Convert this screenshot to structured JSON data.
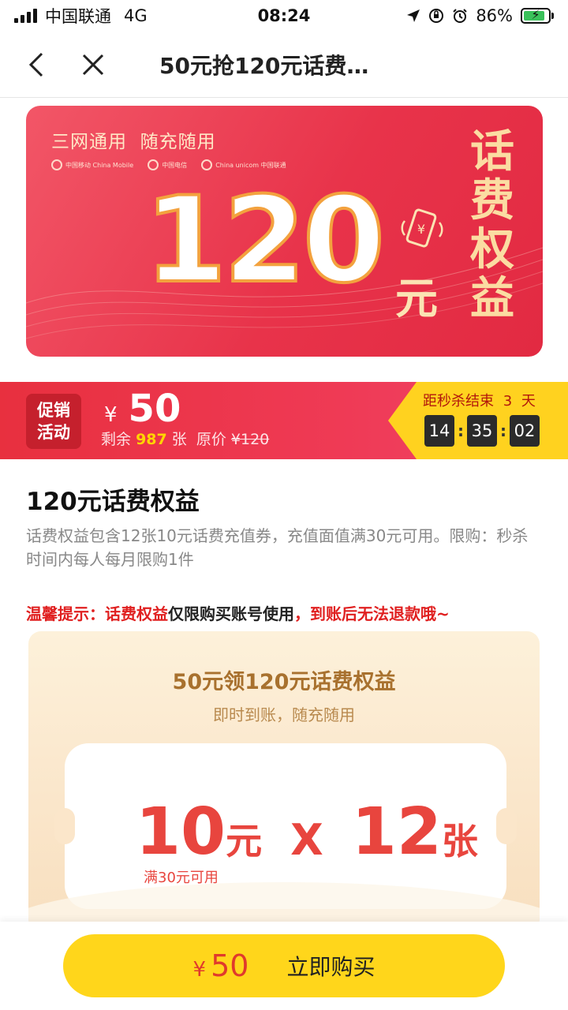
{
  "status_bar": {
    "carrier": "中国联通",
    "network": "4G",
    "time": "08:24",
    "battery": "86%",
    "battery_level": 0.86
  },
  "nav": {
    "title": "50元抢120元话费…"
  },
  "banner": {
    "slogan": "三网通用  随充随用",
    "logos": [
      "中国移动 China Mobile",
      "中国电信",
      "China unicom 中国联通"
    ],
    "amount": "120",
    "unit": "元",
    "vertical_title": "话费权益",
    "phone_icon_symbol": "¥"
  },
  "promo": {
    "badge_line1": "促销",
    "badge_line2": "活动",
    "currency": "¥",
    "price": "50",
    "remaining_prefix": "剩余",
    "remaining_count": "987",
    "remaining_suffix": "张  原价",
    "original_price": "¥120",
    "countdown_label": "距秒杀结束",
    "countdown_days": "3",
    "countdown_days_unit": "天",
    "hours": "14",
    "minutes": "35",
    "seconds": "02"
  },
  "product": {
    "title": "120元话费权益",
    "description": "话费权益包含12张10元话费充值券，充值面值满30元可用。限购：秒杀时间内每人每月限购1件",
    "notice_part1": "温馨提示：话费权益",
    "notice_part2": "仅限购买账号使用",
    "notice_part3": "，到账后无法退款哦~"
  },
  "coupon_card": {
    "title": "50元领120元话费权益",
    "subtitle": "即时到账，随充随用",
    "value": "10",
    "value_unit": "元",
    "times": "X",
    "count": "12",
    "count_unit": "张",
    "condition": "满30元可用"
  },
  "bottom_bar": {
    "currency": "¥",
    "price": "50",
    "buy_label": "立即购买"
  },
  "colors": {
    "banner_red": "#e8334a",
    "gold": "#fbdca2",
    "countdown_yellow": "#ffd21f",
    "button_yellow": "#ffd61b",
    "price_red": "#e03a2c"
  }
}
